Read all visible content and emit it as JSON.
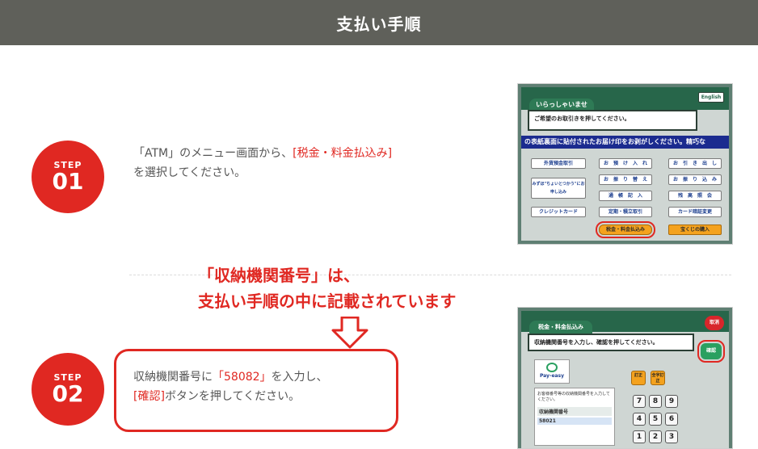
{
  "header": {
    "title": "支払い手順"
  },
  "steps": [
    {
      "label": "STEP",
      "number": "01",
      "text_before": "「ATM」のメニュー画面から、",
      "text_highlight": "[税金・料金払込み]",
      "text_after": "を選択してください。"
    },
    {
      "label": "STEP",
      "number": "02",
      "line1_before": "収納機関番号に",
      "line1_highlight": "「58082」",
      "line1_after": "を入力し、",
      "line2_highlight": "[確認]",
      "line2_after": "ボタンを押してください。"
    }
  ],
  "callout": {
    "line1": "「収納機関番号」は、",
    "line2": "支払い手順の中に記載されています"
  },
  "atm1": {
    "english": "English",
    "welcome": "いらっしゃいませ",
    "message": "ご希望のお取引きを押してください。",
    "ticker": "の表紙裏面に貼付されたお届け印をお剥がしください。精巧な",
    "buttons": {
      "forex": "外貨預金取引",
      "mizuho": "みずほ\"ちょいとつかう\"にお申し込み",
      "credit": "クレジットカード",
      "deposit": "お　預　け　入　れ",
      "transfer_change": "お　振　り　替　え",
      "passbook": "通　帳　記　入",
      "fixed": "定期・積立取引",
      "tax": "税金・料金払込み",
      "withdraw": "お　引　き　出　し",
      "furikomi": "お　振　り　込　み",
      "balance": "残　高　照　会",
      "pin_change": "カード暗証変更",
      "all_purchase": "宝くじの購入"
    }
  },
  "atm2": {
    "tab": "税金・料金払込み",
    "cancel": "取消",
    "message": "収納機関番号を入力し、確認を押してください。",
    "confirm": "確認",
    "payeasy": "Pay-easy",
    "panel_text": "お客様番号等の収納機関番号を入力してください。",
    "panel_label": "収納機関番号",
    "panel_value": "58021",
    "btn_correct": "訂正",
    "btn_all_correct": "全字訂正",
    "keys": [
      "7",
      "8",
      "9",
      "4",
      "5",
      "6",
      "1",
      "2",
      "3"
    ]
  },
  "colors": {
    "header_bg": "#5f605a",
    "accent": "#e02822",
    "atm_green": "#27664a"
  }
}
